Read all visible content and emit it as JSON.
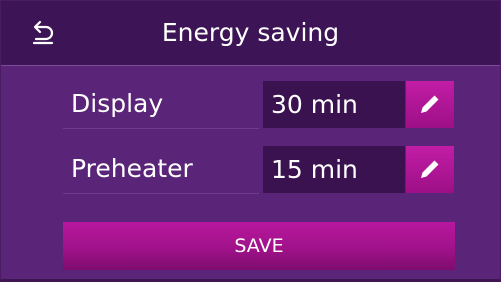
{
  "header": {
    "title": "Energy saving",
    "back_icon": "undo-arrow-icon"
  },
  "settings": [
    {
      "label": "Display",
      "value": "30 min",
      "edit_icon": "pencil-icon"
    },
    {
      "label": "Preheater",
      "value": "15 min",
      "edit_icon": "pencil-icon"
    }
  ],
  "actions": {
    "save_label": "SAVE"
  },
  "colors": {
    "background": "#5a2478",
    "header": "#3d1455",
    "value_box": "#3a1250",
    "accent": "#b8179f"
  }
}
